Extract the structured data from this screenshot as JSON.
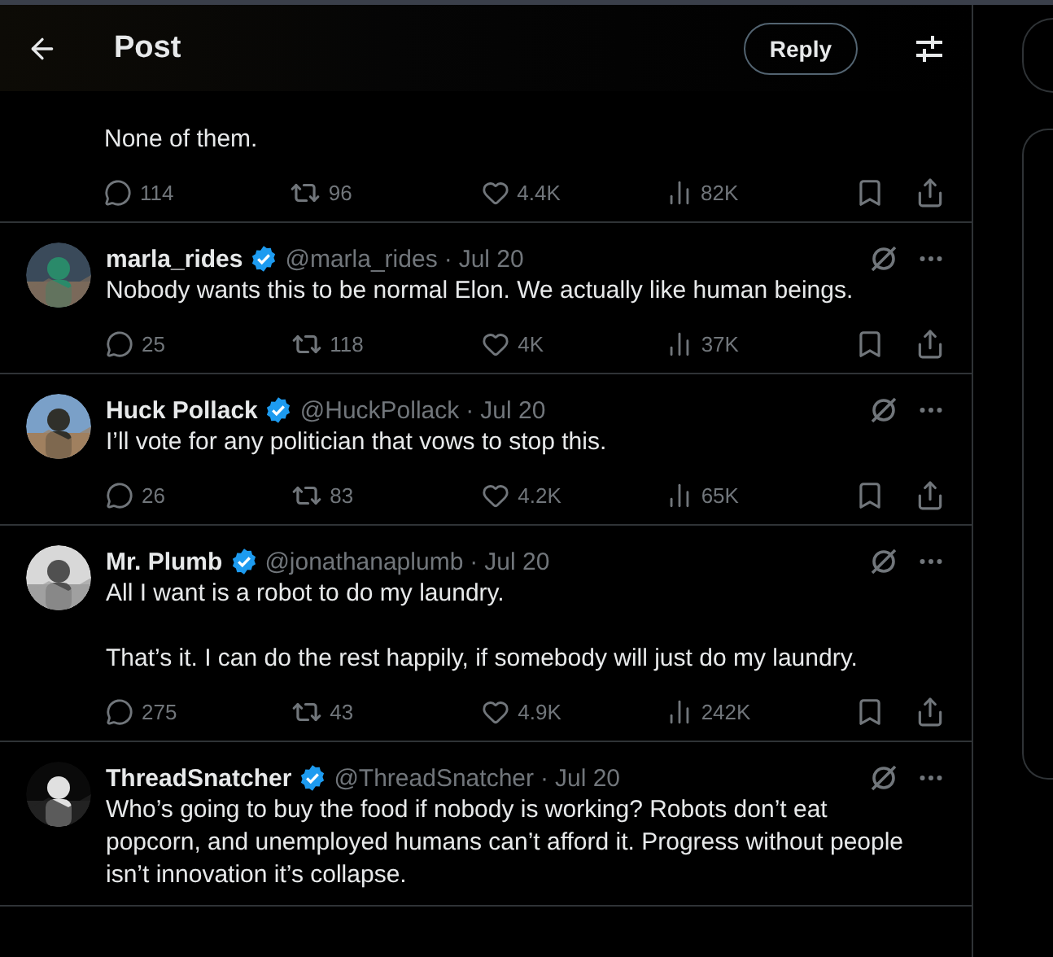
{
  "header": {
    "title": "Post",
    "reply_button": "Reply"
  },
  "main_post": {
    "text": "None of them.",
    "stats": {
      "replies": "114",
      "reposts": "96",
      "likes": "4.4K",
      "views": "82K"
    }
  },
  "replies": [
    {
      "name": "marla_rides",
      "verified": true,
      "handle": "@marla_rides",
      "separator": "·",
      "date": "Jul 20",
      "paragraphs": [
        "Nobody wants this to be normal Elon. We actually like human beings."
      ],
      "stats": {
        "replies": "25",
        "reposts": "118",
        "likes": "4K",
        "views": "37K"
      }
    },
    {
      "name": "Huck Pollack",
      "verified": true,
      "handle": "@HuckPollack",
      "separator": "·",
      "date": "Jul 20",
      "paragraphs": [
        "I’ll vote for any politician that vows to stop this."
      ],
      "stats": {
        "replies": "26",
        "reposts": "83",
        "likes": "4.2K",
        "views": "65K"
      }
    },
    {
      "name": "Mr. Plumb",
      "verified": true,
      "handle": "@jonathanaplumb",
      "separator": "·",
      "date": "Jul 20",
      "paragraphs": [
        "All I want is a robot to do my laundry.",
        "That’s it. I can do the rest happily, if somebody will just do my laundry."
      ],
      "stats": {
        "replies": "275",
        "reposts": "43",
        "likes": "4.9K",
        "views": "242K"
      }
    },
    {
      "name": "ThreadSnatcher",
      "verified": true,
      "handle": "@ThreadSnatcher",
      "separator": "·",
      "date": "Jul 20",
      "paragraphs": [
        "Who’s going to buy the food if nobody is working? Robots don’t eat popcorn, and unemployed humans can’t afford it. Progress without people isn’t innovation it’s collapse."
      ]
    }
  ]
}
